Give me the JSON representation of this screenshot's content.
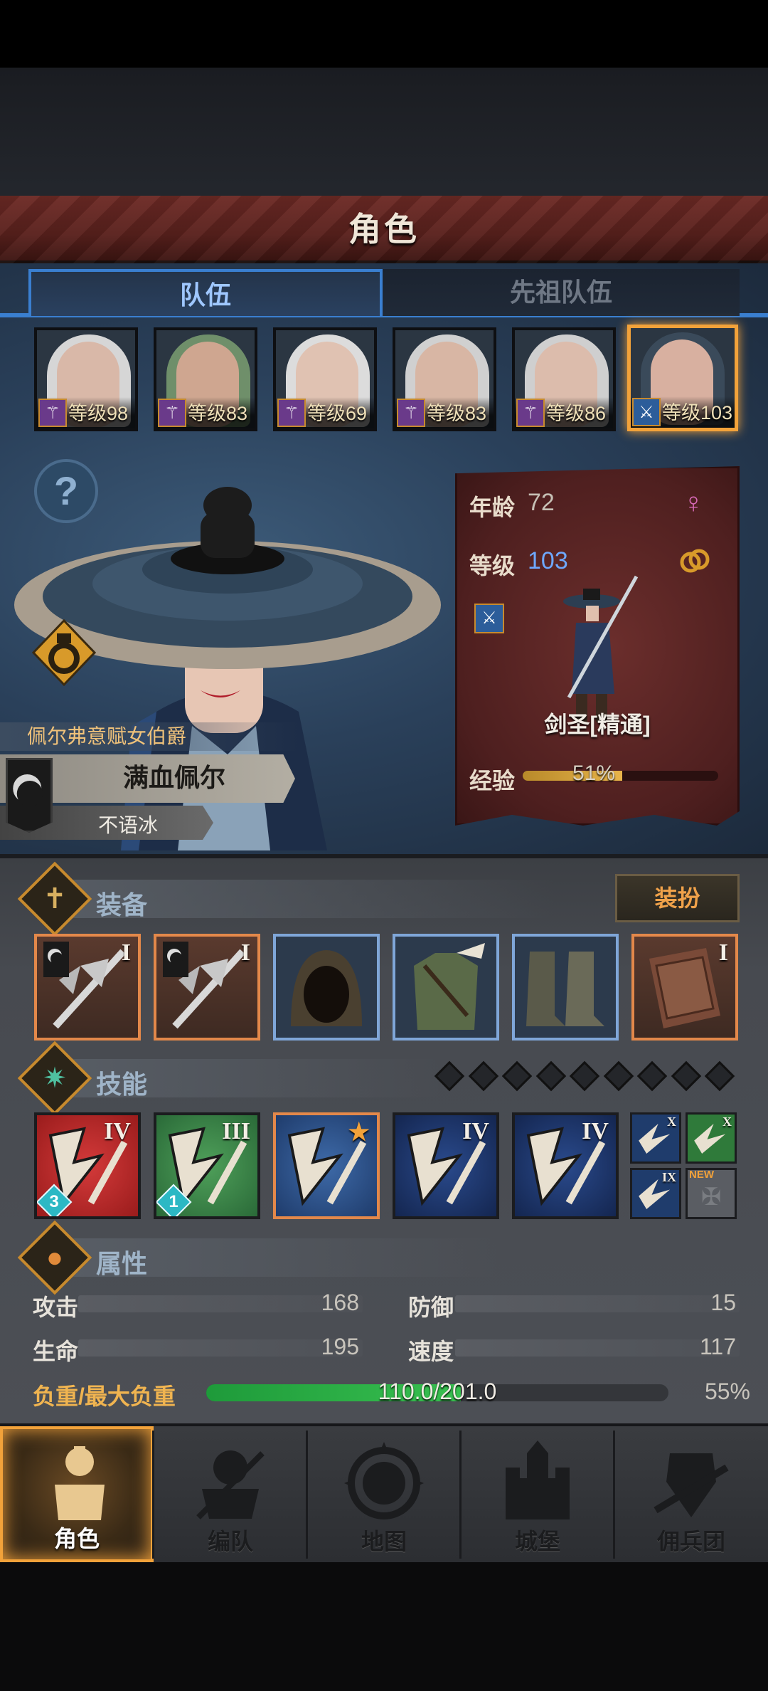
{
  "header": {
    "title": "角色"
  },
  "tabs": [
    {
      "label": "队伍",
      "active": true
    },
    {
      "label": "先祖队伍",
      "active": false
    }
  ],
  "roster": [
    {
      "level_text": "等级98",
      "weapon_icon": "staff-icon",
      "hair": "#d6d6d6",
      "skin": "#d9b8a8"
    },
    {
      "level_text": "等级83",
      "weapon_icon": "staff-icon",
      "hair": "#6f8f6a",
      "skin": "#cfa690"
    },
    {
      "level_text": "等级69",
      "weapon_icon": "staff-icon",
      "hair": "#dcdcdc",
      "skin": "#e0c2b2"
    },
    {
      "level_text": "等级83",
      "weapon_icon": "staff-icon",
      "hair": "#d0d0d0",
      "skin": "#d8b6a4"
    },
    {
      "level_text": "等级86",
      "weapon_icon": "staff-icon",
      "hair": "#cfcfcf",
      "skin": "#dcbcac"
    },
    {
      "level_text": "等级103",
      "weapon_icon": "sword-icon",
      "hair": "#3a4a5a",
      "skin": "#d8b0a0",
      "selected": true
    }
  ],
  "hero": {
    "title": "佩尔弗意赋女伯爵",
    "name": "满血佩尔",
    "subname": "不语冰"
  },
  "info": {
    "age_label": "年龄",
    "age": "72",
    "level_label": "等级",
    "level": "103",
    "class_name": "剑圣[精通]",
    "exp_label": "经验",
    "exp_text": "51%",
    "exp_progress": 0.51
  },
  "equipment": {
    "title": "装备",
    "dress_button": "装扮",
    "slots": [
      {
        "name": "halberd",
        "tier": "I",
        "frame": "orange"
      },
      {
        "name": "halberd",
        "tier": "I",
        "frame": "orange"
      },
      {
        "name": "hood",
        "tier": "",
        "frame": "blue"
      },
      {
        "name": "tunic",
        "tier": "",
        "frame": "blue"
      },
      {
        "name": "boots",
        "tier": "",
        "frame": "blue"
      },
      {
        "name": "tome",
        "tier": "I",
        "frame": "orange"
      }
    ]
  },
  "skills": {
    "title": "技能",
    "slots": [
      {
        "color": "red",
        "tier": "IV",
        "gem": "3"
      },
      {
        "color": "green",
        "tier": "III",
        "gem": "1"
      },
      {
        "color": "blue",
        "tier": "",
        "star": true
      },
      {
        "color": "dark",
        "tier": "IV"
      },
      {
        "color": "dark",
        "tier": "IV"
      }
    ],
    "small_slots": [
      {
        "tier": "X"
      },
      {
        "tier": "X"
      },
      {
        "tier": "IX"
      },
      {
        "tier": "",
        "badge": "NEW",
        "locked": true
      }
    ]
  },
  "attributes": {
    "title": "属性",
    "attack_label": "攻击",
    "attack": "168",
    "defense_label": "防御",
    "defense": "15",
    "hp_label": "生命",
    "hp": "195",
    "speed_label": "速度",
    "speed": "117",
    "load_label": "负重/最大负重",
    "load_text": "110.0/201.0",
    "load_pct": "55%",
    "load_progress": 0.55
  },
  "nav": [
    {
      "label": "角色",
      "active": true
    },
    {
      "label": "编队"
    },
    {
      "label": "地图"
    },
    {
      "label": "城堡"
    },
    {
      "label": "佣兵团"
    }
  ],
  "colors": {
    "accent": "#f2a23a",
    "tab_blue": "#3a7fd0",
    "header_red": "#6d2a25"
  }
}
